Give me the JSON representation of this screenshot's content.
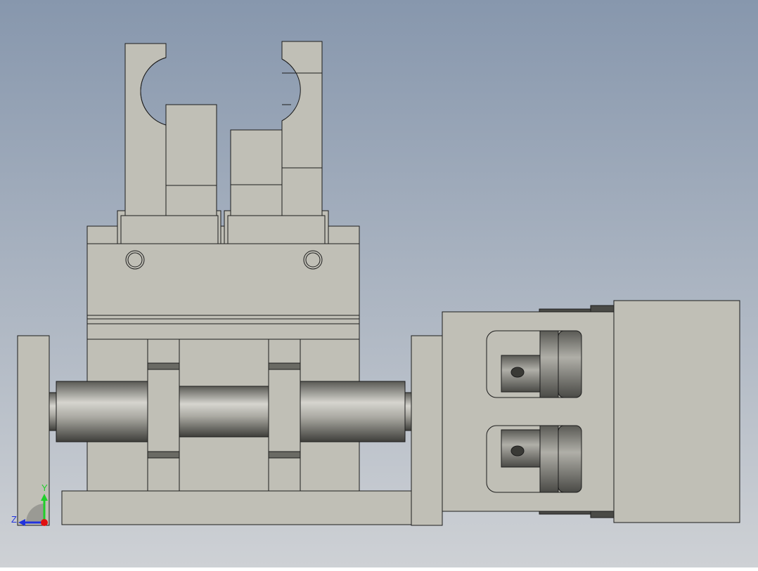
{
  "viewport": {
    "background_top": "#8797ad",
    "background_bottom": "#ced1d5",
    "part_fill": "#c0bfb6",
    "part_stroke": "#1c1c1c",
    "shaft_dark": "#4a4a46",
    "shaft_light": "#d6d5cf"
  },
  "triad": {
    "y_label": "Y",
    "z_label": "Z",
    "y_color": "#1fcf2a",
    "z_color": "#2233dd",
    "x_color": "#e01010"
  }
}
